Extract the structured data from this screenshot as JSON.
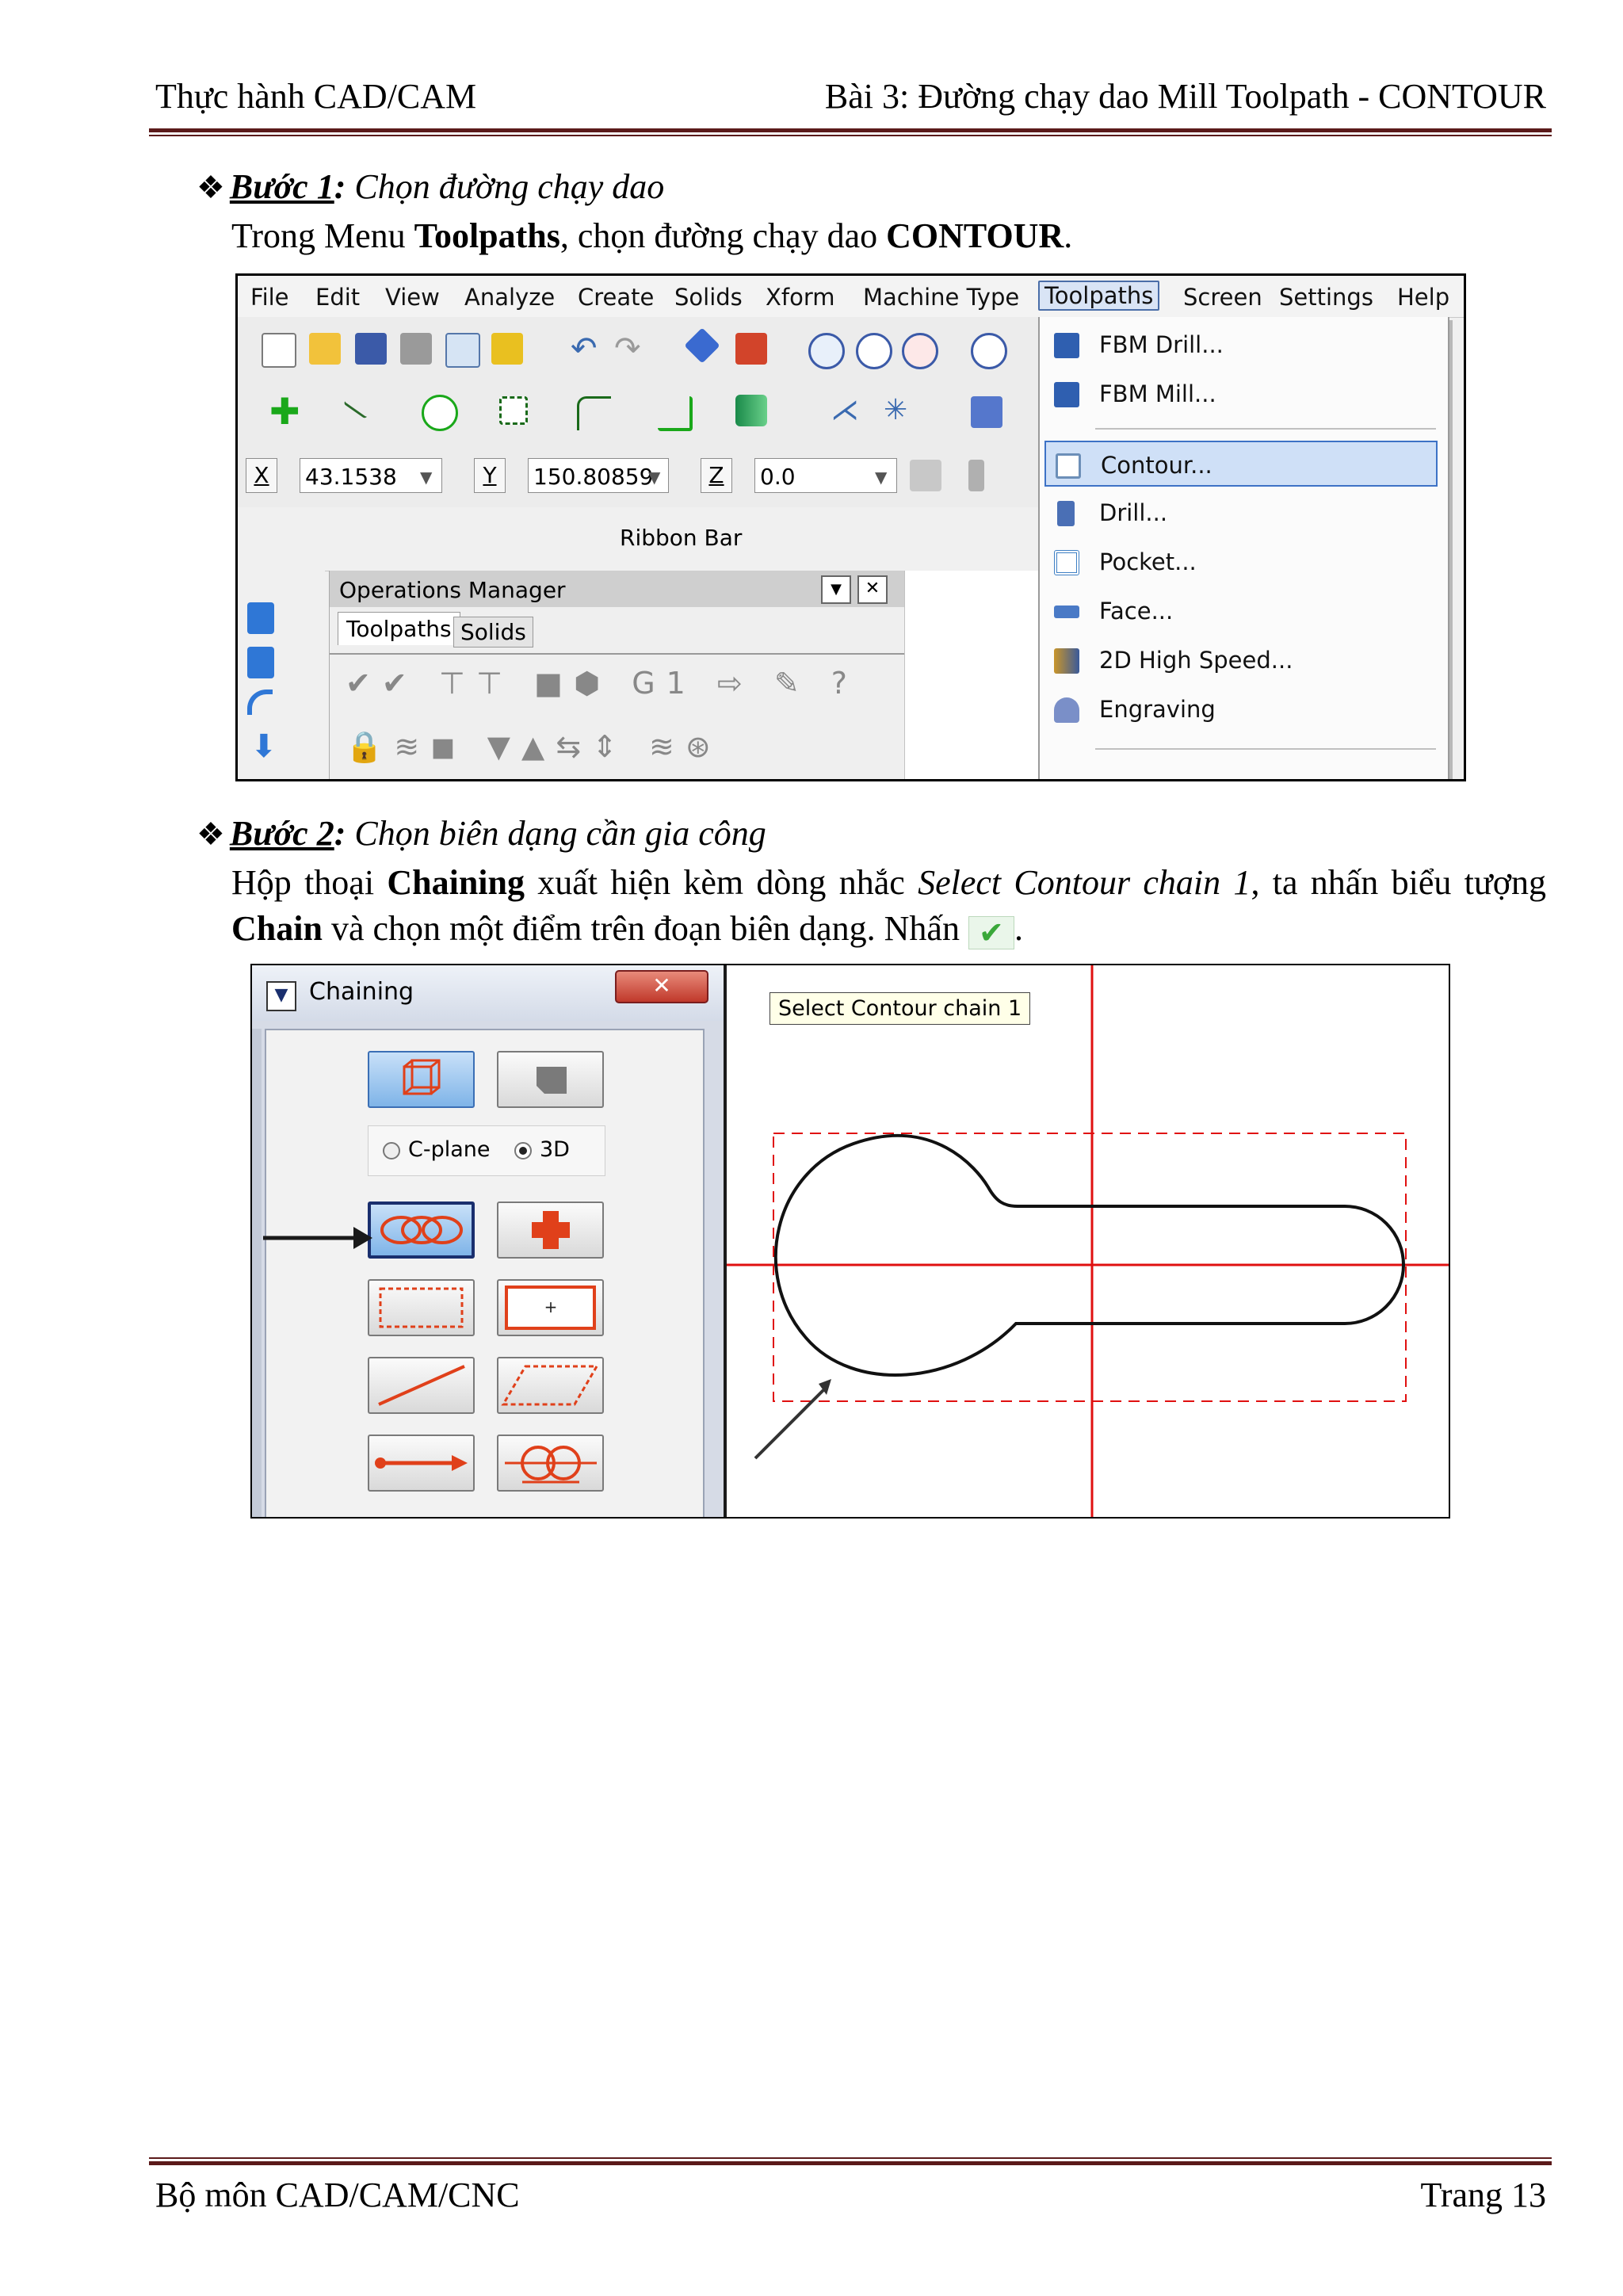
{
  "header": {
    "left": "Thực hành CAD/CAM",
    "right": "Bài 3: Đường chạy dao Mill Toolpath - CONTOUR"
  },
  "step1": {
    "bullet": "❖",
    "label": "Bước 1",
    "colon": ":",
    "title": "Chọn đường chạy dao",
    "para_a": "Trong Menu ",
    "para_b": "Toolpaths",
    "para_c": ", chọn đường chạy dao ",
    "para_d": "CONTOUR",
    "para_e": "."
  },
  "shot1": {
    "menu": [
      "File",
      "Edit",
      "View",
      "Analyze",
      "Create",
      "Solids",
      "Xform",
      "Machine Type",
      "Toolpaths",
      "Screen",
      "Settings",
      "Help"
    ],
    "active_menu": "Toolpaths",
    "x_label": "X",
    "x_value": "43.1538",
    "y_label": "Y",
    "y_value": "150.80859",
    "z_label": "Z",
    "z_value": "0.0",
    "ribbon_label": "Ribbon Bar",
    "ops_title": "Operations Manager",
    "ops_tabs": [
      "Toolpaths",
      "Solids"
    ],
    "dropdown": [
      {
        "label": "FBM Drill...",
        "icon": "fbm-drill-icon",
        "color": "#2f5fb0"
      },
      {
        "label": "FBM Mill...",
        "icon": "fbm-mill-icon",
        "color": "#2f5fb0"
      },
      {
        "label": "Contour...",
        "icon": "contour-icon",
        "color": "#6c8fb8"
      },
      {
        "label": "Drill...",
        "icon": "drill-icon",
        "color": "#4a6fb5"
      },
      {
        "label": "Pocket...",
        "icon": "pocket-icon",
        "color": "#3e7fc4"
      },
      {
        "label": "Face...",
        "icon": "face-icon",
        "color": "#4a7ac6"
      },
      {
        "label": "2D High Speed...",
        "icon": "high-speed-icon",
        "color": "#c9952a"
      },
      {
        "label": "Engraving",
        "icon": "engraving-icon",
        "color": "#7a8fc8"
      }
    ],
    "selected_item": "Contour..."
  },
  "step2": {
    "bullet": "❖",
    "label": "Bước 2",
    "colon": ":",
    "title": "Chọn biên dạng cần gia công",
    "line1_a": "Hộp thoại ",
    "line1_b": "Chaining",
    "line1_c": " xuất hiện kèm dòng nhắc ",
    "line1_d": "Select Contour chain 1",
    "line1_e": ", ta nhấn biểu tượng",
    "line2_a": "Chain",
    "line2_b": " và chọn một điểm trên đoạn biên dạng. Nhấn ",
    "line2_c": "."
  },
  "shot2": {
    "dialog_title": "Chaining",
    "radio_cplane": "C-plane",
    "radio_3d": "3D",
    "radio_selected": "3D",
    "prompt": "Select Contour chain  1",
    "plus_label": "+"
  },
  "colors": {
    "rule": "#5b1a1a",
    "axis_red": "#e01010",
    "chain_red": "#e0401a",
    "ok_green": "#3aa83a"
  },
  "footer": {
    "left": "Bộ môn CAD/CAM/CNC",
    "right": "Trang 13"
  }
}
